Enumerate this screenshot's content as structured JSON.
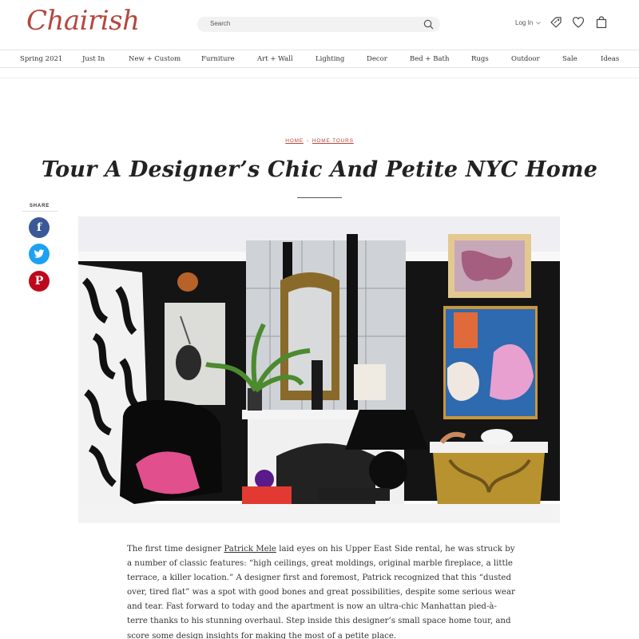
{
  "header": {
    "logo": "Chairish",
    "search_placeholder": "Search",
    "login_label": "Log In"
  },
  "nav": {
    "items": [
      "Spring 2021",
      "Just In",
      "New + Custom",
      "Furniture",
      "Art + Wall",
      "Lighting",
      "Decor",
      "Bed + Bath",
      "Rugs",
      "Outdoor",
      "Sale",
      "Ideas"
    ]
  },
  "breadcrumb": {
    "home": "HOME",
    "separator": "›",
    "section": "HOME TOURS"
  },
  "article": {
    "title": "Tour A Designer’s Chic And Petite NYC Home",
    "body_pre": "The first time designer ",
    "body_link": "Patrick Mele",
    "body_post": " laid eyes on his Upper East Side rental, he was struck by a number of classic features: “high ceilings, great moldings, original marble fireplace, a little terrace, a killer location.” A designer first and foremost, Patrick recognized that this “dusted over, tired flat” was a spot with good bones and great possibilities, despite some serious wear and tear. Fast forward to today and the apartment is now an ultra-chic Manhattan pied-à-terre thanks to his stunning overhaul. Step inside this designer’s small space home tour, and score some design insights for making the most of a petite place."
  },
  "share": {
    "label": "SHARE",
    "facebook": "f",
    "twitter": "t",
    "pinterest": "P"
  },
  "icons": [
    "search-icon",
    "chevron-down-icon",
    "tag-icon",
    "heart-icon",
    "shopping-bag-icon",
    "facebook-icon",
    "twitter-icon",
    "pinterest-icon"
  ],
  "colors": {
    "brand": "#b4473e",
    "facebook": "#3b5998",
    "twitter": "#1da1f2",
    "pinterest": "#bd081c"
  }
}
